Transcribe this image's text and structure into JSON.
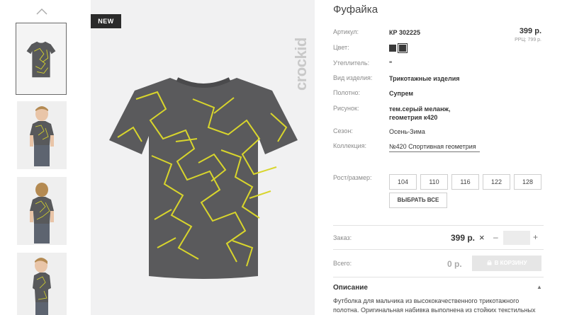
{
  "gallery": {
    "up_icon": "chevron-up-icon",
    "badge": "NEW",
    "brand": "crockid",
    "shirt_color": "#5a5a5c",
    "pattern_color": "#d8d52c"
  },
  "product": {
    "title": "Фуфайка",
    "price": "399 р.",
    "rrp": "РРЦ: 799 р.",
    "attributes": [
      {
        "label": "Артикул:",
        "value": "КР 302225"
      },
      {
        "label": "Цвет:",
        "value": ""
      },
      {
        "label": "Утеплитель:",
        "value": "\""
      },
      {
        "label": "Вид изделия:",
        "value": "Трикотажные изделия"
      },
      {
        "label": "Полотно:",
        "value": "Супрем"
      },
      {
        "label": "Рисунок:",
        "value": "тем.серый меланж, геометрия к420"
      },
      {
        "label": "Сезон:",
        "value": "Осень-Зима"
      },
      {
        "label": "Коллекция:",
        "value": "№420 Спортивная геометрия"
      }
    ],
    "size_label": "Рост/размер:",
    "sizes": [
      "104",
      "110",
      "116",
      "122",
      "128"
    ],
    "select_all": "ВЫБРАТЬ ВСЕ"
  },
  "order": {
    "label": "Заказ:",
    "price": "399 р.",
    "times": "×",
    "minus": "–",
    "plus": "+",
    "total_label": "Всего:",
    "total": "0 р.",
    "cart_button": "В КОРЗИНУ",
    "cart_icon": "lock-icon"
  },
  "description": {
    "title": "Описание",
    "caret": "▲",
    "text": "Футболка для мальчика из высококачественного трикотажного полотна. Оригинальная набивка выполнена из стойких текстильных"
  }
}
